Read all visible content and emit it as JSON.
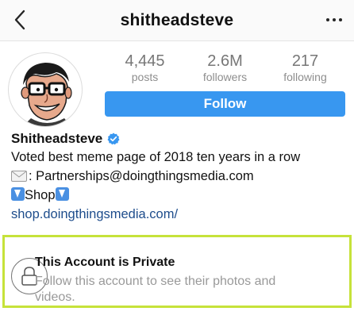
{
  "header": {
    "username": "shitheadsteve",
    "back_icon": "chevron-left-icon",
    "more_icon": "more-horizontal-icon"
  },
  "profile": {
    "avatar_icon": "cartoon-avatar",
    "stats": [
      {
        "value": "4,445",
        "label": "posts"
      },
      {
        "value": "2.6M",
        "label": "followers"
      },
      {
        "value": "217",
        "label": "following"
      }
    ],
    "follow_label": "Follow",
    "follow_color": "#3897f0"
  },
  "bio": {
    "name": "Shitheadsteve",
    "verified_icon": "verified-badge-icon",
    "verified_color": "#3897f0",
    "line1": "Voted best meme page of 2018 ten years in a row",
    "line2_text": ": Partnerships@doingthingsmedia.com",
    "line3_text": "Shop",
    "link": "shop.doingthingsmedia.com/"
  },
  "private_notice": {
    "title": "This Account is Private",
    "subtitle": "Follow this account to see their photos and videos.",
    "highlight_color": "#c6e23a",
    "icon": "lock-icon"
  }
}
